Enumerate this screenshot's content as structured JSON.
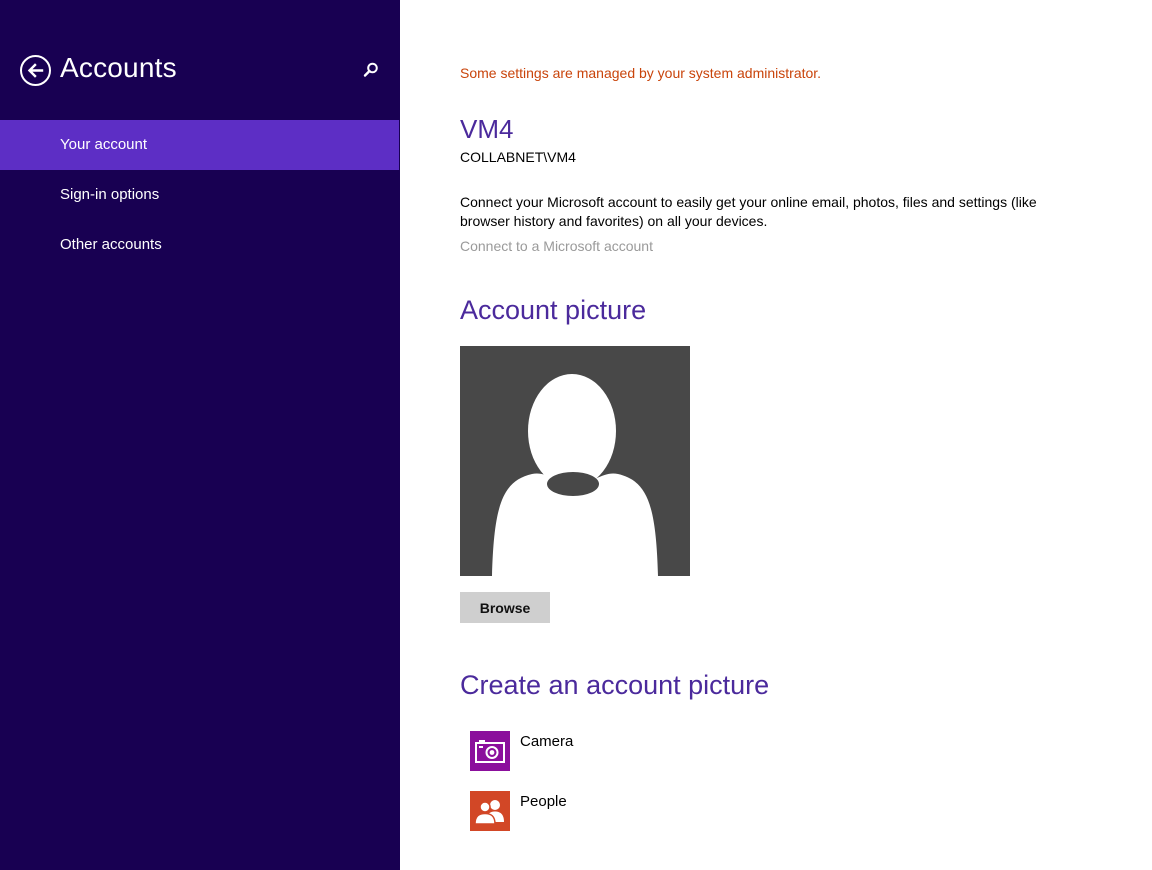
{
  "sidebar": {
    "title": "Accounts",
    "back_icon": "back-arrow-icon",
    "search_icon": "search-icon",
    "items": [
      {
        "label": "Your account",
        "selected": true
      },
      {
        "label": "Sign-in options",
        "selected": false
      },
      {
        "label": "Other accounts",
        "selected": false
      }
    ]
  },
  "main": {
    "admin_notice": "Some settings are managed by your system administrator.",
    "account": {
      "name": "VM4",
      "domain": "COLLABNET\\VM4"
    },
    "connect": {
      "description": "Connect your Microsoft account to easily get your online email, photos, files and settings (like browser history and favorites) on all your devices.",
      "link_label": "Connect to a Microsoft account"
    },
    "account_picture": {
      "heading": "Account picture",
      "browse_label": "Browse"
    },
    "create_picture": {
      "heading": "Create an account picture",
      "apps": [
        {
          "label": "Camera",
          "icon": "camera-icon",
          "color": "#8b0f9c"
        },
        {
          "label": "People",
          "icon": "people-icon",
          "color": "#d24726"
        }
      ]
    }
  },
  "colors": {
    "sidebar_bg": "#180052",
    "selected_item_bg": "#5d2ec5",
    "heading_purple": "#4b2a9c",
    "admin_notice": "#c9440b"
  }
}
